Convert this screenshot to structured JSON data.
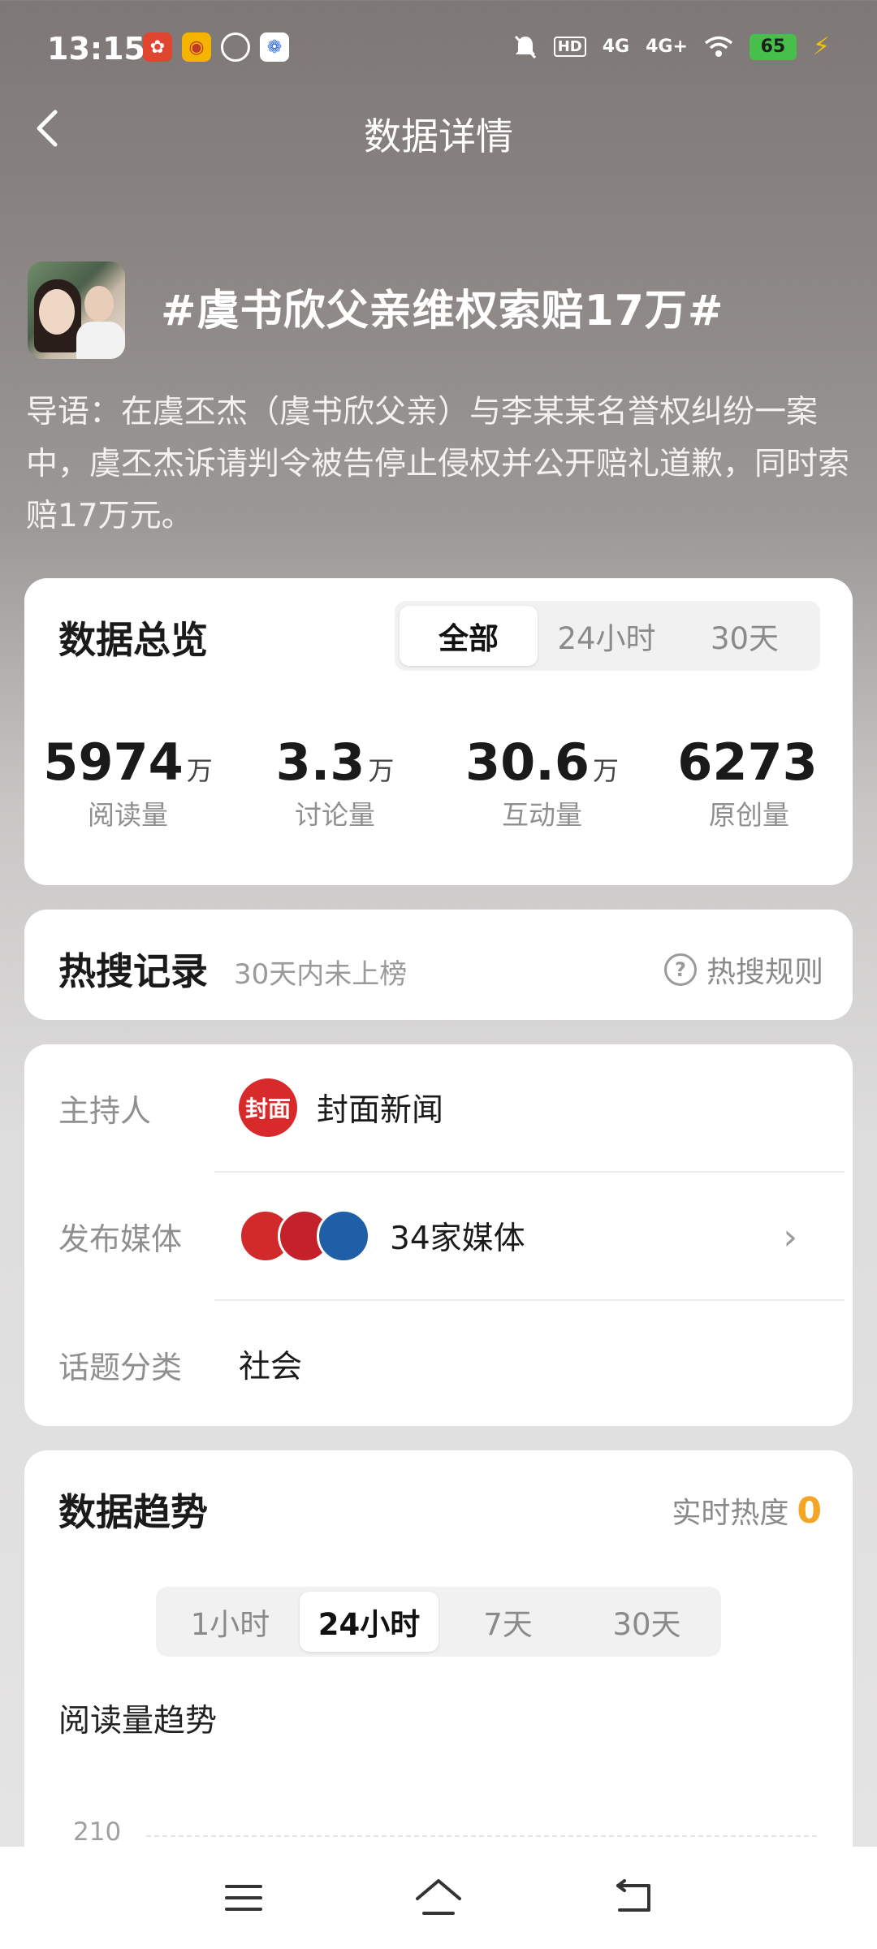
{
  "status_bar": {
    "time": "13:15",
    "signal_1": "4G",
    "signal_2": "4G+",
    "battery": "65",
    "hd": "HD"
  },
  "header": {
    "title": "数据详情"
  },
  "topic": {
    "title": "#虞书欣父亲维权索赔17万#",
    "intro": "导语：在虞丕杰（虞书欣父亲）与李某某名誉权纠纷一案中，虞丕杰诉请判令被告停止侵权并公开赔礼道歉，同时索赔17万元。"
  },
  "overview": {
    "title": "数据总览",
    "tabs": [
      "全部",
      "24小时",
      "30天"
    ],
    "stats": [
      {
        "value": "5974",
        "unit": "万",
        "label": "阅读量"
      },
      {
        "value": "3.3",
        "unit": "万",
        "label": "讨论量"
      },
      {
        "value": "30.6",
        "unit": "万",
        "label": "互动量"
      },
      {
        "value": "6273",
        "unit": "",
        "label": "原创量"
      }
    ]
  },
  "hot_search": {
    "title": "热搜记录",
    "subtitle": "30天内未上榜",
    "rule_label": "热搜规则"
  },
  "info": {
    "host_label": "主持人",
    "host_name": "封面新闻",
    "host_logo_text": "封面",
    "media_label": "发布媒体",
    "media_count": "34家媒体",
    "category_label": "话题分类",
    "category_value": "社会"
  },
  "trend": {
    "title": "数据趋势",
    "realtime_label": "实时热度",
    "realtime_value": "0",
    "tabs": [
      "1小时",
      "24小时",
      "7天",
      "30天"
    ],
    "subtitle": "阅读量趋势",
    "y_tick": "210"
  },
  "colors": {
    "accent_orange": "#f5a524",
    "host_red": "#d82a2a"
  }
}
